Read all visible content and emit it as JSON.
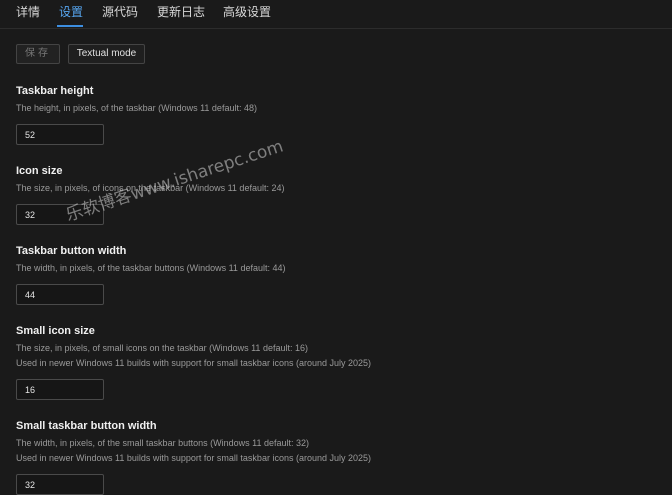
{
  "tabs": [
    "详情",
    "设置",
    "源代码",
    "更新日志",
    "高级设置"
  ],
  "active_tab": "设置",
  "toolbar": {
    "save_label": "保存",
    "textual_label": "Textual mode"
  },
  "settings": [
    {
      "title": "Taskbar height",
      "desc": [
        "The height, in pixels, of the taskbar (Windows 11 default: 48)"
      ],
      "value": "52"
    },
    {
      "title": "Icon size",
      "desc": [
        "The size, in pixels, of icons on the taskbar (Windows 11 default: 24)"
      ],
      "value": "32"
    },
    {
      "title": "Taskbar button width",
      "desc": [
        "The width, in pixels, of the taskbar buttons (Windows 11 default: 44)"
      ],
      "value": "44"
    },
    {
      "title": "Small icon size",
      "desc": [
        "The size, in pixels, of small icons on the taskbar (Windows 11 default: 16)",
        "Used in newer Windows 11 builds with support for small taskbar icons (around July 2025)"
      ],
      "value": "16"
    },
    {
      "title": "Small taskbar button width",
      "desc": [
        "The width, in pixels, of the small taskbar buttons (Windows 11 default: 32)",
        "Used in newer Windows 11 builds with support for small taskbar icons (around July 2025)"
      ],
      "value": "32"
    }
  ],
  "watermark": "乐软博客www.isharepc.com",
  "colors": {
    "accent": "#3d8ee0",
    "background": "#1a1a1a"
  }
}
